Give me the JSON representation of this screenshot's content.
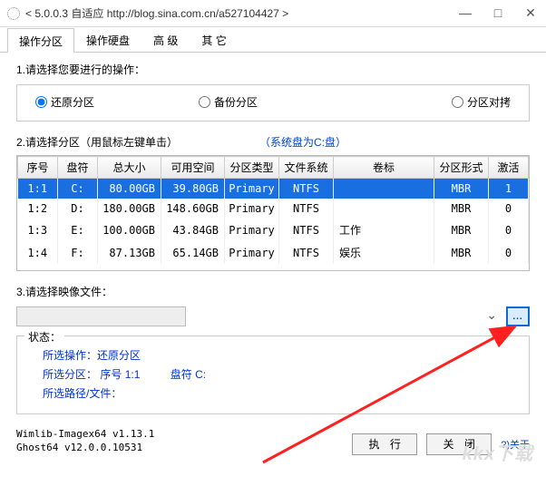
{
  "window": {
    "title": "< 5.0.0.3 自适应 http://blog.sina.com.cn/a527104427 >"
  },
  "tabs": [
    {
      "label": "操作分区",
      "active": true
    },
    {
      "label": "操作硬盘",
      "active": false
    },
    {
      "label": "高  级",
      "active": false
    },
    {
      "label": "其  它",
      "active": false
    }
  ],
  "section1": {
    "label": "1.请选择您要进行的操作：",
    "options": [
      {
        "label": "还原分区",
        "checked": true
      },
      {
        "label": "备份分区",
        "checked": false
      },
      {
        "label": "分区对拷",
        "checked": false
      }
    ]
  },
  "section2": {
    "label": "2.请选择分区（用鼠标左键单击）",
    "hint": "（系统盘为C:盘）",
    "columns": [
      "序号",
      "盘符",
      "总大小",
      "可用空间",
      "分区类型",
      "文件系统",
      "卷标",
      "分区形式",
      "激活"
    ],
    "rows": [
      {
        "seq": "1:1",
        "drv": "C:",
        "total": "80.00GB",
        "free": "39.80GB",
        "ptype": "Primary",
        "fs": "NTFS",
        "vol": "",
        "pform": "MBR",
        "act": "1",
        "selected": true
      },
      {
        "seq": "1:2",
        "drv": "D:",
        "total": "180.00GB",
        "free": "148.60GB",
        "ptype": "Primary",
        "fs": "NTFS",
        "vol": "",
        "pform": "MBR",
        "act": "0",
        "selected": false
      },
      {
        "seq": "1:3",
        "drv": "E:",
        "total": "100.00GB",
        "free": "43.84GB",
        "ptype": "Primary",
        "fs": "NTFS",
        "vol": "工作",
        "pform": "MBR",
        "act": "0",
        "selected": false
      },
      {
        "seq": "1:4",
        "drv": "F:",
        "total": "87.13GB",
        "free": "65.14GB",
        "ptype": "Primary",
        "fs": "NTFS",
        "vol": "娱乐",
        "pform": "MBR",
        "act": "0",
        "selected": false
      }
    ]
  },
  "section3": {
    "label": "3.请选择映像文件：",
    "value": "",
    "browse": "..."
  },
  "status": {
    "title": "状态：",
    "line1_label": "所选操作：",
    "line1_value": "还原分区",
    "line2_seq_label": "所选分区：  序号",
    "line2_seq_value": "1:1",
    "line2_drv_label": "盘符",
    "line2_drv_value": "C:",
    "line3": "所选路径/文件："
  },
  "footer": {
    "line1": "Wimlib-Imagex64  v1.13.1",
    "line2": "Ghost64  v12.0.0.10531",
    "exec": "执 行",
    "close": "关 闭",
    "about": "?)关于"
  },
  "watermark": "kkx下载"
}
